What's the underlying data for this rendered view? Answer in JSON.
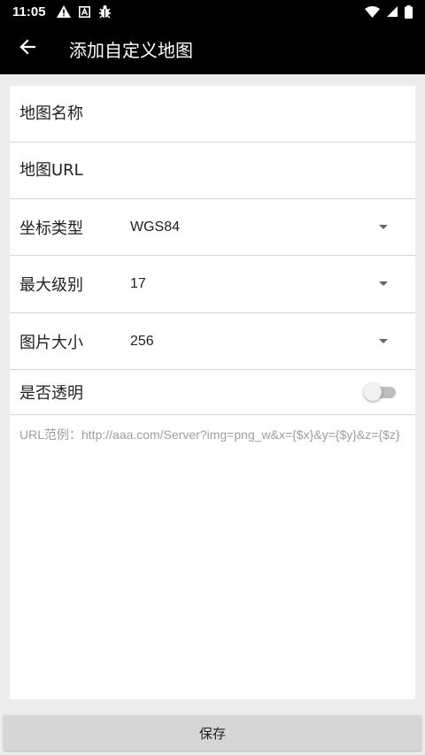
{
  "status_bar": {
    "time": "11:05",
    "left_icons": [
      "warning-icon",
      "a-box-icon",
      "bug-icon"
    ],
    "right_icons": [
      "wifi-icon",
      "signal-icon",
      "battery-icon"
    ]
  },
  "app_bar": {
    "title": "添加自定义地图",
    "back_icon": "arrow-back-icon"
  },
  "form": {
    "map_name": {
      "placeholder": "地图名称"
    },
    "map_url": {
      "placeholder": "地图URL"
    },
    "coord_type": {
      "label": "坐标类型",
      "value": "WGS84"
    },
    "max_level": {
      "label": "最大级别",
      "value": "17"
    },
    "image_size": {
      "label": "图片大小",
      "value": "256"
    },
    "transparent": {
      "label": "是否透明",
      "enabled": false
    },
    "hint": "URL范例：http://aaa.com/Server?img=png_w&x={$x}&y={$y}&z={$z}"
  },
  "save_button": {
    "label": "保存"
  }
}
